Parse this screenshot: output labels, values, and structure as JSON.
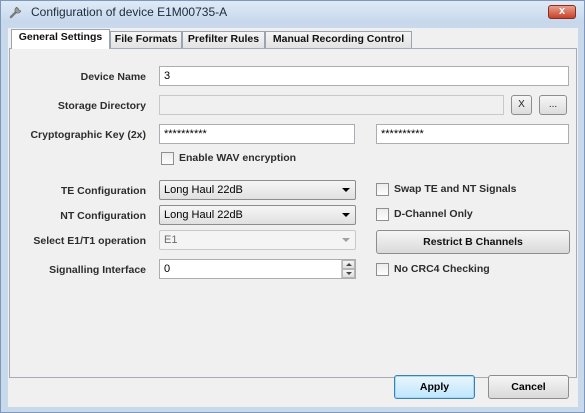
{
  "window": {
    "title": "Configuration of device E1M00735-A",
    "close_glyph": "x"
  },
  "tabs": [
    {
      "label": "General Settings",
      "active": true
    },
    {
      "label": "File Formats",
      "active": false
    },
    {
      "label": "Prefilter Rules",
      "active": false
    },
    {
      "label": "Manual Recording Control",
      "active": false
    }
  ],
  "form": {
    "device_name": {
      "label": "Device Name",
      "value": "3"
    },
    "storage_directory": {
      "label": "Storage Directory",
      "value": "",
      "clear_label": "X",
      "browse_label": "..."
    },
    "crypto_key": {
      "label": "Cryptographic Key (2x)",
      "value1": "**********",
      "value2": "**********"
    },
    "enable_wav_encryption": {
      "label": "Enable WAV encryption",
      "checked": false
    },
    "te_configuration": {
      "label": "TE Configuration",
      "value": "Long Haul 22dB"
    },
    "nt_configuration": {
      "label": "NT Configuration",
      "value": "Long Haul 22dB"
    },
    "e1t1_operation": {
      "label": "Select E1/T1 operation",
      "value": "E1",
      "disabled": true
    },
    "signalling_interface": {
      "label": "Signalling Interface",
      "value": "0"
    },
    "swap_te_nt": {
      "label": "Swap TE and NT Signals",
      "checked": false
    },
    "d_channel_only": {
      "label": "D-Channel Only",
      "checked": false
    },
    "restrict_b_channels": {
      "label": "Restrict B Channels"
    },
    "no_crc4": {
      "label": "No CRC4 Checking",
      "checked": false
    }
  },
  "buttons": {
    "apply": "Apply",
    "cancel": "Cancel"
  },
  "icons": {
    "title_icon": "wrench-icon"
  },
  "colors": {
    "frame": "#c9d9ec",
    "client": "#f0f0f0",
    "close": "#c7432a",
    "apply_accent": "#bee6fd"
  }
}
